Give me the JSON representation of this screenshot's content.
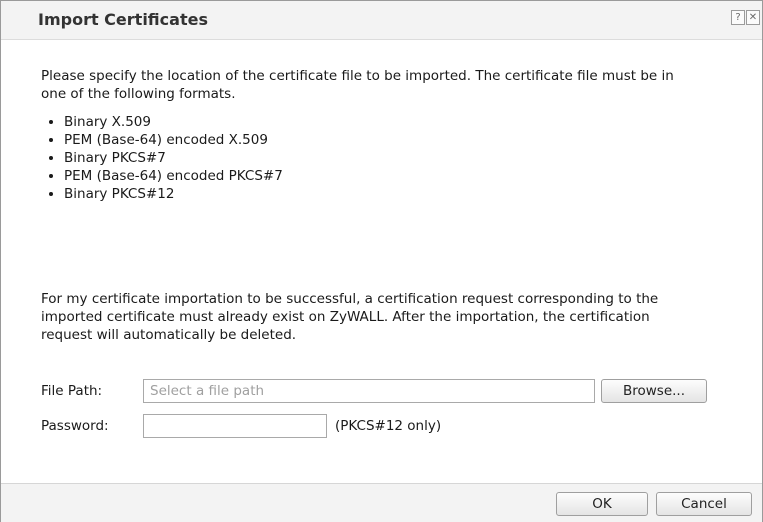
{
  "dialog": {
    "title": "Import Certificates",
    "help_icon": "question-mark",
    "close_icon": "x-mark"
  },
  "intro": "Please specify the location of the certificate file to be imported. The certificate file must be in one of the following formats.",
  "formats": [
    "Binary X.509",
    "PEM (Base-64) encoded X.509",
    "Binary PKCS#7",
    "PEM (Base-64) encoded PKCS#7",
    "Binary PKCS#12"
  ],
  "note": "For my certificate importation to be successful, a certification request corresponding to the imported certificate must already exist on ZyWALL. After the importation, the certification request will automatically be deleted.",
  "file_path": {
    "label": "File Path:",
    "placeholder": "Select a file path",
    "value": "",
    "browse_label": "Browse..."
  },
  "password": {
    "label": "Password:",
    "value": "",
    "hint": "(PKCS#12 only)"
  },
  "buttons": {
    "ok": "OK",
    "cancel": "Cancel"
  }
}
